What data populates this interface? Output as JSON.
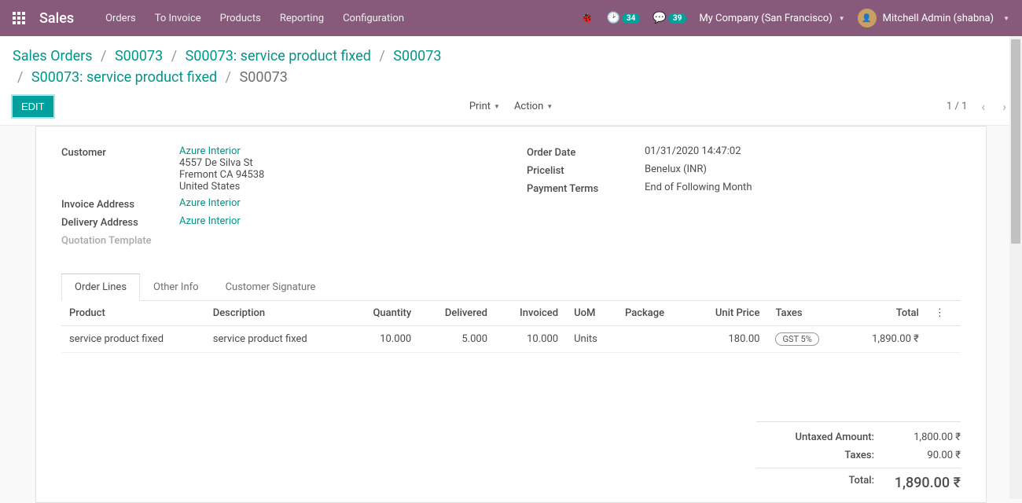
{
  "navbar": {
    "brand": "Sales",
    "menu": [
      "Orders",
      "To Invoice",
      "Products",
      "Reporting",
      "Configuration"
    ],
    "badge_activities": "34",
    "badge_discuss": "39",
    "company": "My Company (San Francisco)",
    "user": "Mitchell Admin (shabna)"
  },
  "breadcrumb": {
    "items": [
      "Sales Orders",
      "S00073",
      "S00073: service product fixed",
      "S00073",
      "S00073: service product fixed"
    ],
    "active": "S00073"
  },
  "buttons": {
    "edit": "Edit",
    "print": "Print",
    "action": "Action"
  },
  "pager": {
    "current": "1",
    "total": "1"
  },
  "form": {
    "labels": {
      "customer": "Customer",
      "invoice_address": "Invoice Address",
      "delivery_address": "Delivery Address",
      "quotation_template": "Quotation Template",
      "order_date": "Order Date",
      "pricelist": "Pricelist",
      "payment_terms": "Payment Terms"
    },
    "customer": {
      "name": "Azure Interior",
      "street": "4557 De Silva St",
      "city": "Fremont CA 94538",
      "country": "United States"
    },
    "invoice_address": "Azure Interior",
    "delivery_address": "Azure Interior",
    "order_date": "01/31/2020 14:47:02",
    "pricelist": "Benelux (INR)",
    "payment_terms": "End of Following Month"
  },
  "tabs": {
    "order_lines": "Order Lines",
    "other_info": "Other Info",
    "customer_signature": "Customer Signature"
  },
  "table": {
    "headers": {
      "product": "Product",
      "description": "Description",
      "quantity": "Quantity",
      "delivered": "Delivered",
      "invoiced": "Invoiced",
      "uom": "UoM",
      "package": "Package",
      "unit_price": "Unit Price",
      "taxes": "Taxes",
      "total": "Total"
    },
    "rows": [
      {
        "product": "service product fixed",
        "description": "service product fixed",
        "quantity": "10.000",
        "delivered": "5.000",
        "invoiced": "10.000",
        "uom": "Units",
        "package": "",
        "unit_price": "180.00",
        "taxes": "GST 5%",
        "total": "1,890.00 ₹"
      }
    ]
  },
  "totals": {
    "untaxed_label": "Untaxed Amount:",
    "untaxed_value": "1,800.00 ₹",
    "taxes_label": "Taxes:",
    "taxes_value": "90.00 ₹",
    "total_label": "Total:",
    "total_value": "1,890.00 ₹"
  }
}
